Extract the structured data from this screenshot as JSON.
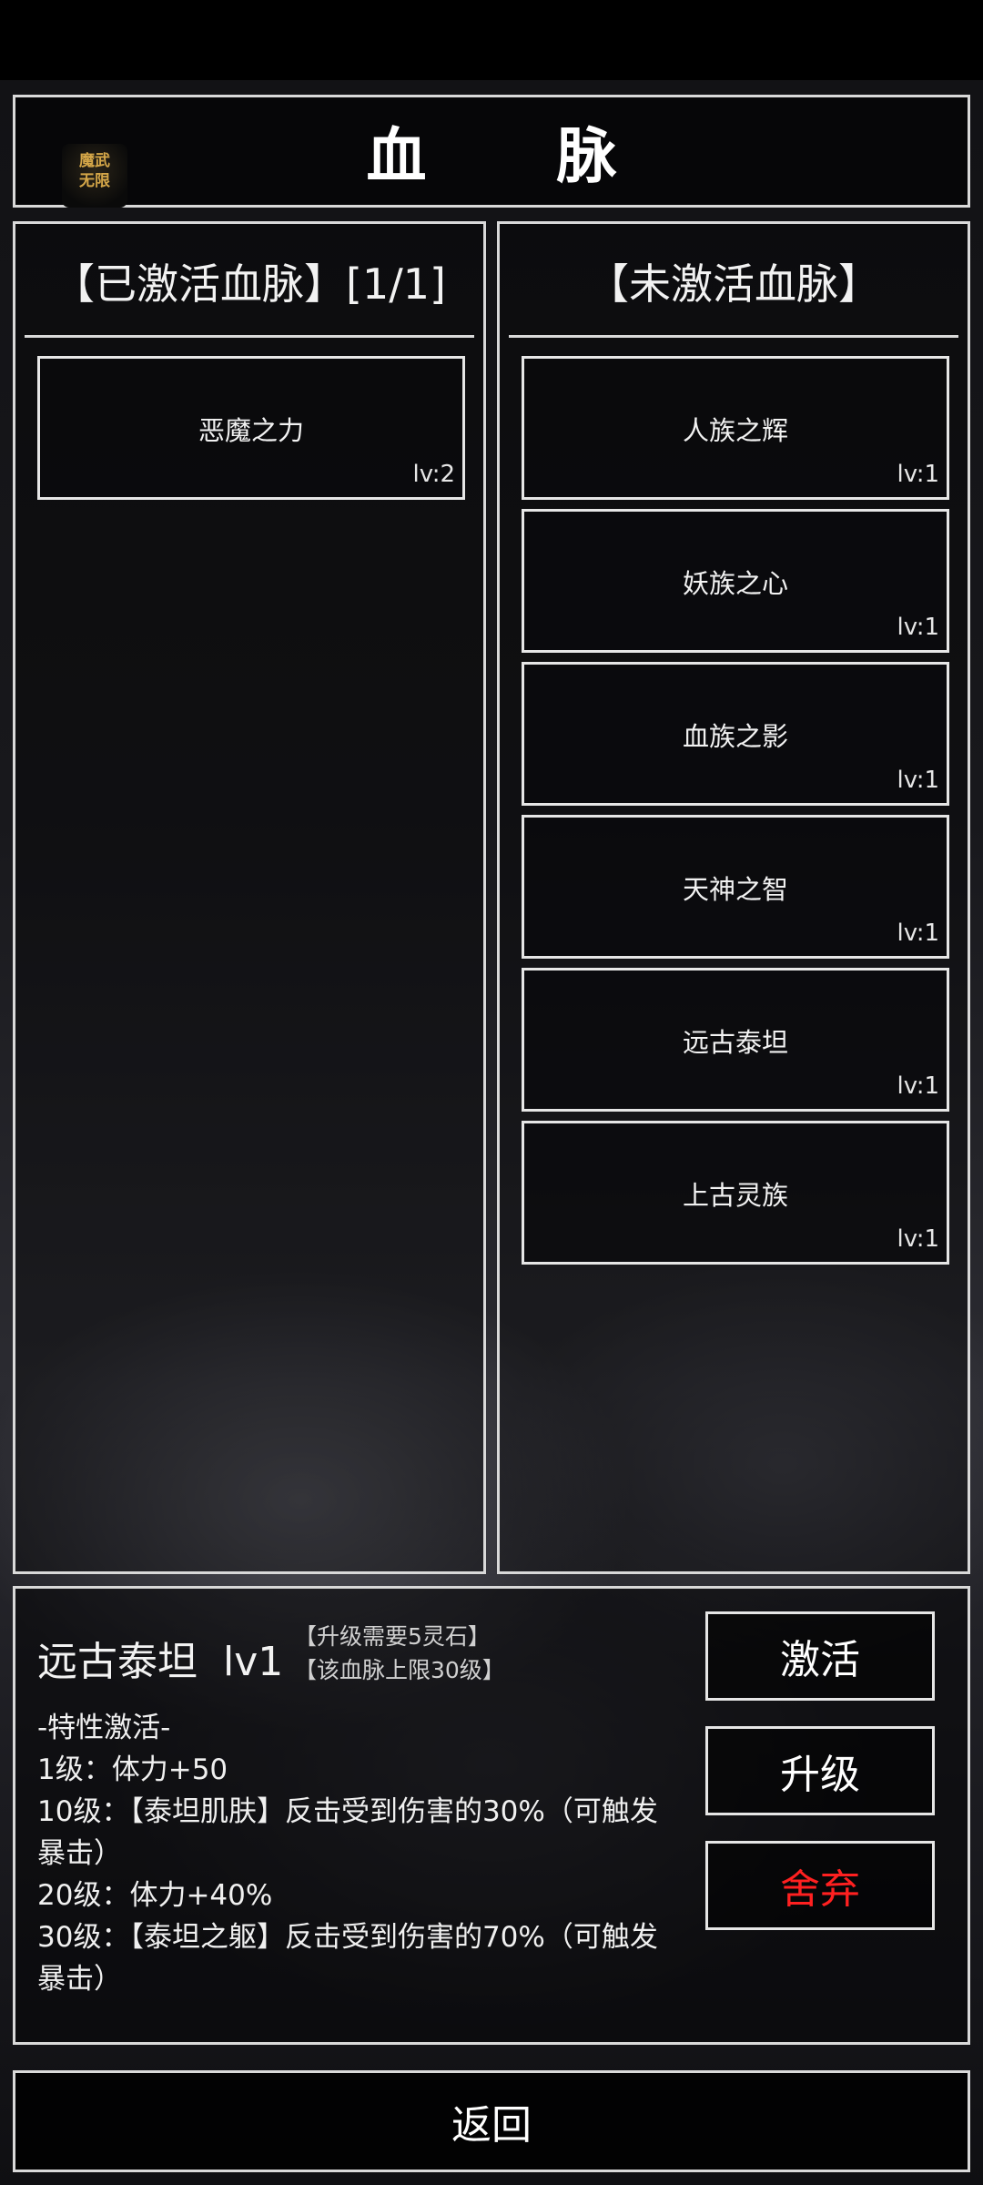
{
  "header": {
    "title": "血 脉",
    "logo_text": "魔武\n无限"
  },
  "activated_panel": {
    "title": "【已激活血脉】[1/1]",
    "items": [
      {
        "name": "恶魔之力",
        "level": "lv:2"
      }
    ]
  },
  "inactive_panel": {
    "title": "【未激活血脉】",
    "items": [
      {
        "name": "人族之辉",
        "level": "lv:1"
      },
      {
        "name": "妖族之心",
        "level": "lv:1"
      },
      {
        "name": "血族之影",
        "level": "lv:1"
      },
      {
        "name": "天神之智",
        "level": "lv:1"
      },
      {
        "name": "远古泰坦",
        "level": "lv:1"
      },
      {
        "name": "上古灵族",
        "level": "lv:1"
      }
    ]
  },
  "detail": {
    "name_level": "远古泰坦  lv1",
    "upgrade_cost": "【升级需要5灵石】",
    "level_cap": "【该血脉上限30级】",
    "traits_title": "-特性激活-",
    "traits": [
      "1级：体力+50",
      "10级：【泰坦肌肤】反击受到伤害的30%（可触发暴击）",
      "20级：体力+40%",
      "30级：【泰坦之躯】反击受到伤害的70%（可触发暴击）"
    ]
  },
  "actions": {
    "activate": "激活",
    "upgrade": "升级",
    "abandon": "舍弃",
    "back": "返回"
  },
  "colors": {
    "border": "#d9d9d9",
    "danger": "#ff2020"
  }
}
